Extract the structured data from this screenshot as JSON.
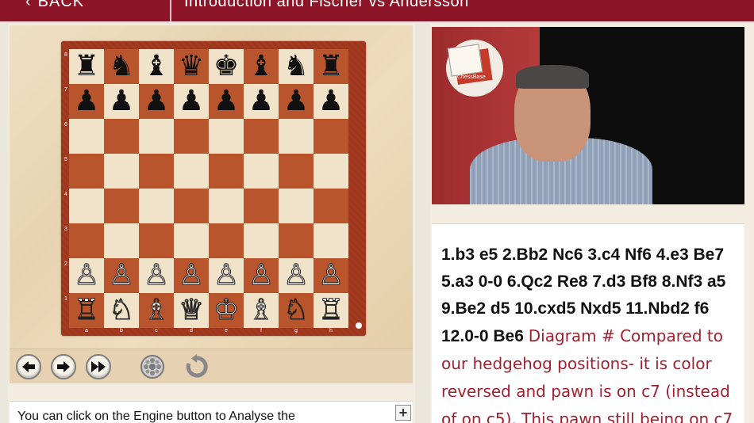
{
  "header": {
    "back_label": "BACK",
    "title": "Introduction and Fischer vs Andersson"
  },
  "board": {
    "rows": [
      [
        "♜",
        "♞",
        "♝",
        "♛",
        "♚",
        "♝",
        "♞",
        "♜"
      ],
      [
        "♟",
        "♟",
        "♟",
        "♟",
        "♟",
        "♟",
        "♟",
        "♟"
      ],
      [
        "",
        "",
        "",
        "",
        "",
        "",
        "",
        ""
      ],
      [
        "",
        "",
        "",
        "",
        "",
        "",
        "",
        ""
      ],
      [
        "",
        "",
        "",
        "",
        "",
        "",
        "",
        ""
      ],
      [
        "",
        "",
        "",
        "",
        "",
        "",
        "",
        ""
      ],
      [
        "♙",
        "♙",
        "♙",
        "♙",
        "♙",
        "♙",
        "♙",
        "♙"
      ],
      [
        "♖",
        "♘",
        "♗",
        "♕",
        "♔",
        "♗",
        "♘",
        "♖"
      ]
    ],
    "ranks": [
      "8",
      "7",
      "6",
      "5",
      "4",
      "3",
      "2",
      "1"
    ],
    "files": [
      "a",
      "b",
      "c",
      "d",
      "e",
      "f",
      "g",
      "h"
    ]
  },
  "controls": {
    "back_move_icon": "arrow-left-icon",
    "forward_move_icon": "arrow-right-icon",
    "fast_forward_icon": "fast-forward-icon",
    "engine_icon": "engine-icon",
    "flip_icon": "rotate-icon"
  },
  "notes": {
    "text": "You can click on the Engine button to Analyse the",
    "expand_label": "+"
  },
  "video": {
    "logo_text": "ChessBase"
  },
  "moves": {
    "notation": "1.b3 e5 2.Bb2 Nc6 3.c4 Nf6 4.e3 Be7 5.a3 0-0 6.Qc2 Re8 7.d3 Bf8 8.Nf3 a5 9.Be2 d5 10.cxd5 Nxd5 11.Nbd2 f6 12.0-0 Be6",
    "comment": "Diagram # Compared to our hedgehog positions- it is color reversed and pawn is on c7 (instead of on c5). This pawn still being on c7"
  },
  "colors": {
    "brand": "#8b1527",
    "dark_square": "#b9552c",
    "light_square": "#f1e3c9",
    "comment": "#a02130"
  }
}
